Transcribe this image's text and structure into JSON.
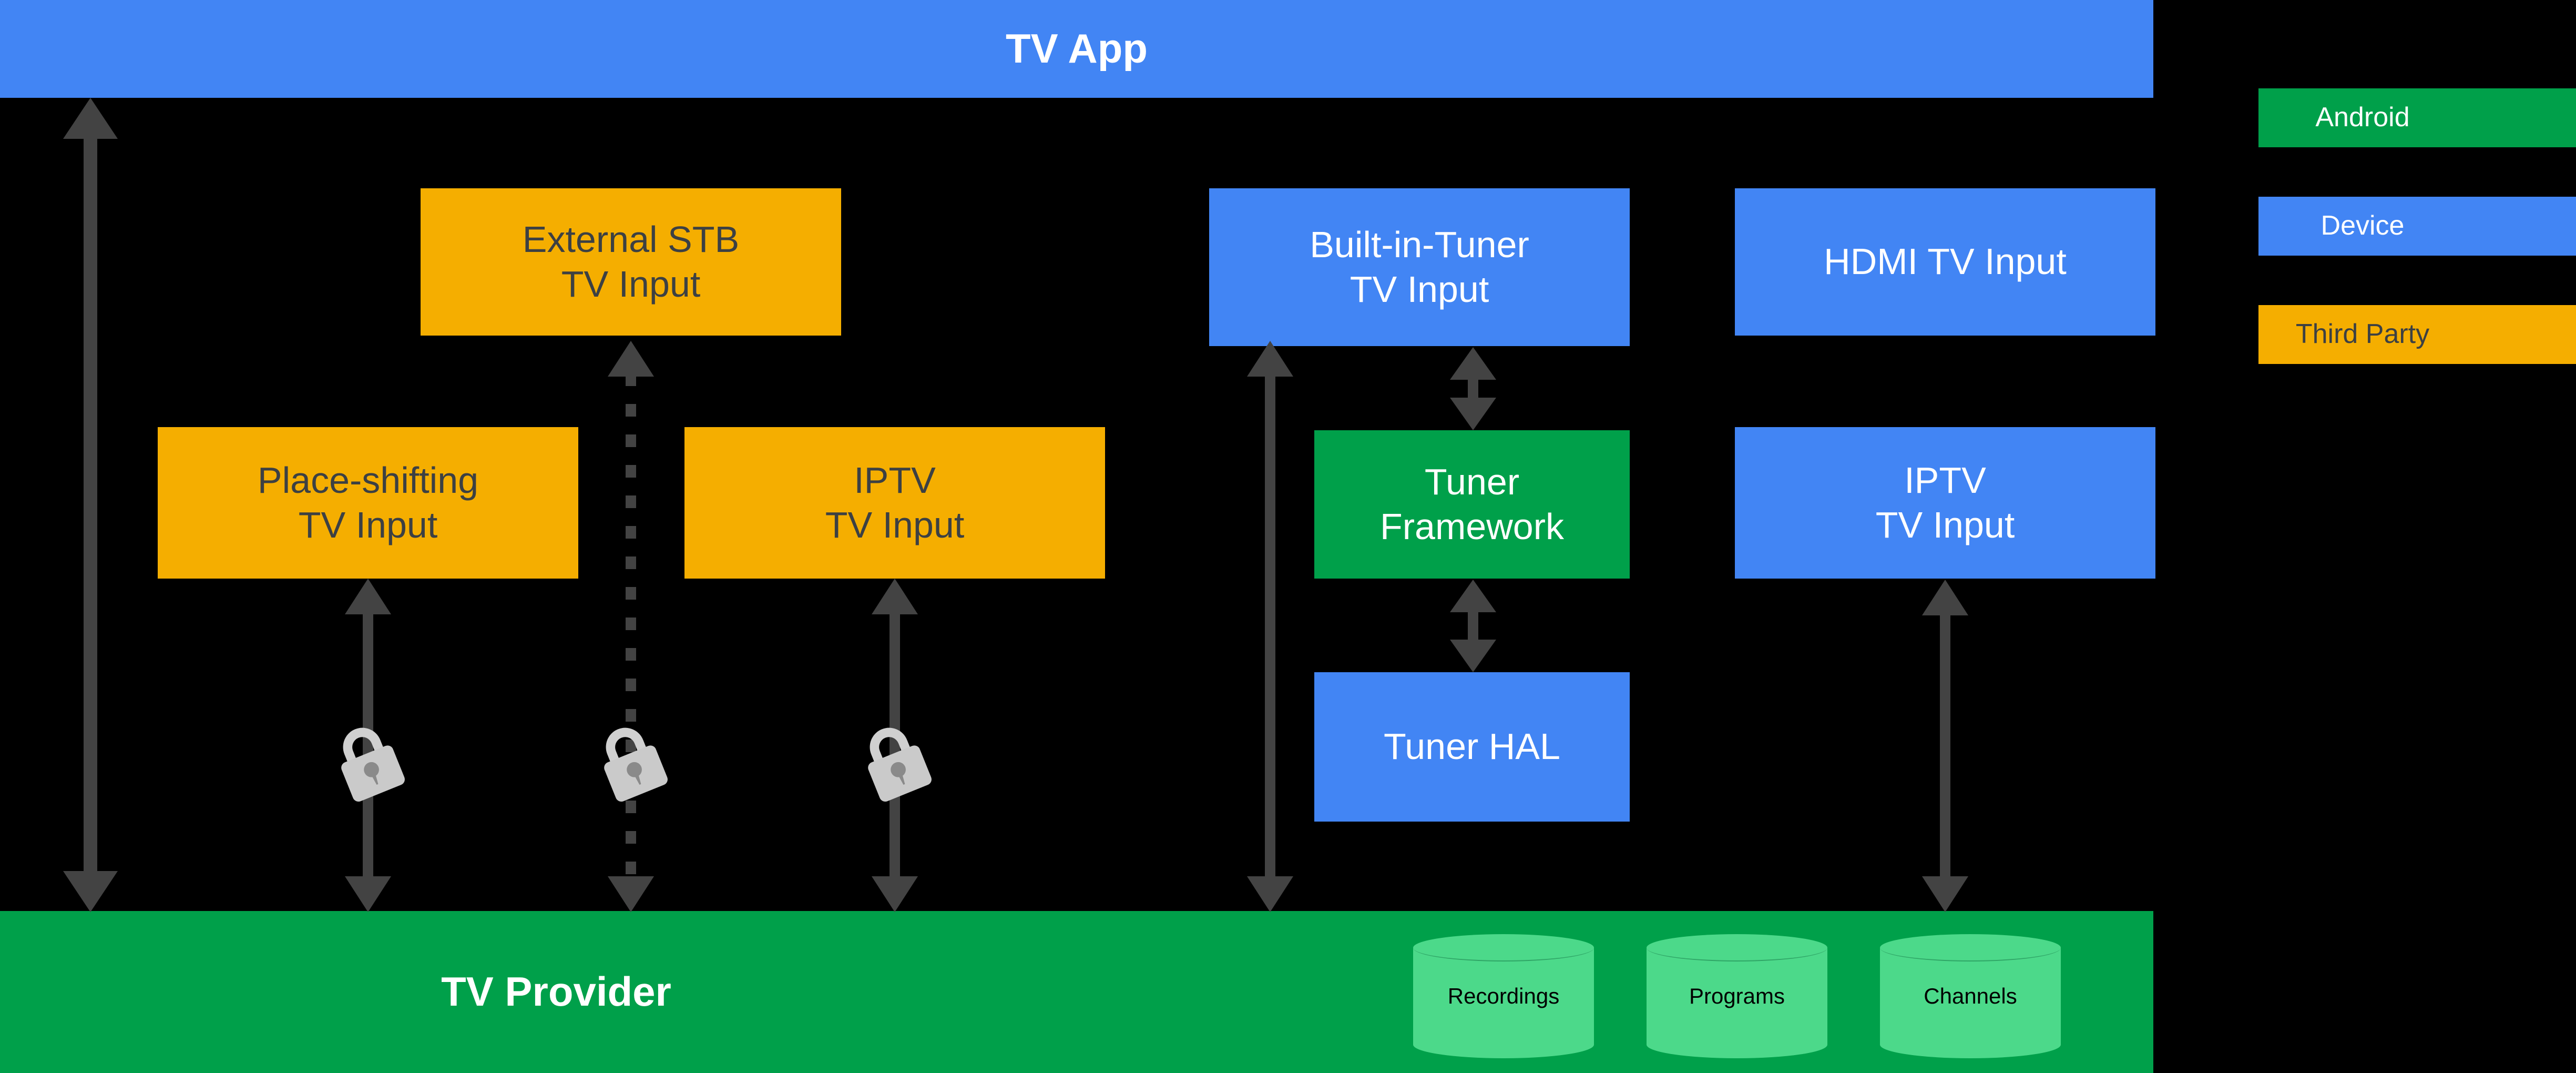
{
  "diagram": {
    "title_bar": {
      "label": "TV App",
      "color": "#4285F4"
    },
    "bottom_bar": {
      "label": "TV Provider",
      "color": "#00A04A"
    },
    "nodes": [
      {
        "id": "external-stb-tv-input",
        "label": "External STB\nTV Input",
        "color": "#F5AE00",
        "category": "Third Party"
      },
      {
        "id": "place-shifting-tv-input",
        "label": "Place-shifting\nTV Input",
        "color": "#F5AE00",
        "category": "Third Party"
      },
      {
        "id": "iptv-tv-input-left",
        "label": "IPTV\nTV Input",
        "color": "#F5AE00",
        "category": "Third Party"
      },
      {
        "id": "built-in-tuner-tv-input",
        "label": "Built-in-Tuner\nTV Input",
        "color": "#4285F4",
        "category": "Device"
      },
      {
        "id": "tuner-framework",
        "label": "Tuner\nFramework",
        "color": "#00A04A",
        "category": "Android"
      },
      {
        "id": "tuner-hal",
        "label": "Tuner HAL",
        "color": "#4285F4",
        "category": "Device"
      },
      {
        "id": "hdmi-tv-input",
        "label": "HDMI TV Input",
        "color": "#4285F4",
        "category": "Device"
      },
      {
        "id": "iptv-tv-input-right",
        "label": "IPTV\nTV Input",
        "color": "#4285F4",
        "category": "Device"
      }
    ],
    "databases": [
      {
        "id": "recordings",
        "label": "Recordings"
      },
      {
        "id": "programs",
        "label": "Programs"
      },
      {
        "id": "channels",
        "label": "Channels"
      }
    ],
    "legend": [
      {
        "id": "android",
        "label": "Android",
        "color": "#00A04A",
        "text_color": "#FFFFFF"
      },
      {
        "id": "device",
        "label": "Device",
        "color": "#4285F4",
        "text_color": "#FFFFFF"
      },
      {
        "id": "third-party",
        "label": "Third Party",
        "color": "#F5AE00",
        "text_color": "#3C4043"
      }
    ],
    "connectors": [
      {
        "id": "tv-app-to-tv-provider",
        "style": "solid",
        "heads": "both",
        "secured": false
      },
      {
        "id": "place-shifting-to-tv-provider",
        "style": "solid",
        "heads": "both",
        "secured": true
      },
      {
        "id": "external-stb-to-tv-provider",
        "style": "dashed",
        "heads": "both",
        "secured": true
      },
      {
        "id": "iptv-left-to-tv-provider",
        "style": "solid",
        "heads": "both",
        "secured": true
      },
      {
        "id": "built-in-tuner-to-tv-provider",
        "style": "solid",
        "heads": "both",
        "secured": false
      },
      {
        "id": "built-in-tuner-to-tuner-framework",
        "style": "solid",
        "heads": "both",
        "secured": false
      },
      {
        "id": "tuner-framework-to-tuner-hal",
        "style": "solid",
        "heads": "both",
        "secured": false
      },
      {
        "id": "iptv-right-to-tv-provider",
        "style": "solid",
        "heads": "both",
        "secured": false
      }
    ],
    "icons": {
      "lock": "lock-icon"
    }
  }
}
